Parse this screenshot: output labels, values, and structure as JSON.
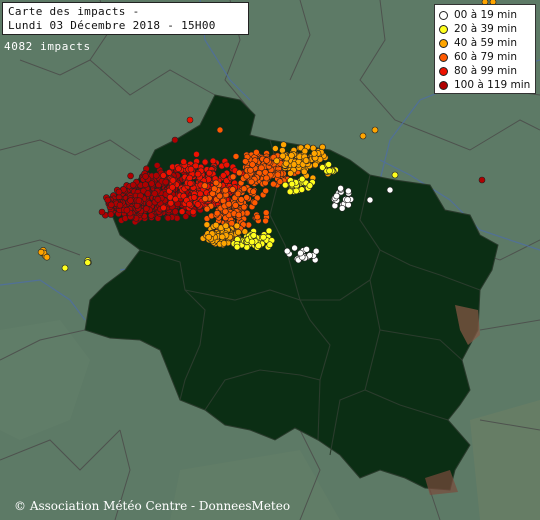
{
  "title": {
    "line1": "Carte des impacts -",
    "line2": "Lundi 03 Décembre 2018 - 15H00"
  },
  "impact_count": "4082 impacts",
  "legend": [
    {
      "label": "00 à 19 min",
      "color": "#ffffff"
    },
    {
      "label": "20 à 39 min",
      "color": "#ffff1e"
    },
    {
      "label": "40 à 59 min",
      "color": "#ffa500"
    },
    {
      "label": "60 à 79 min",
      "color": "#ff5a00"
    },
    {
      "label": "80 à 99 min",
      "color": "#ee1100"
    },
    {
      "label": "100 à 119 min",
      "color": "#b00000"
    }
  ],
  "copyright": "© Association Météo Centre - DonneesMeteo",
  "colors": {
    "land": "#5d7a66",
    "region": "#0b2e14",
    "borders": "#4a4f4a",
    "rivers": "#4f6fa0",
    "relief": "#8a5a46"
  }
}
